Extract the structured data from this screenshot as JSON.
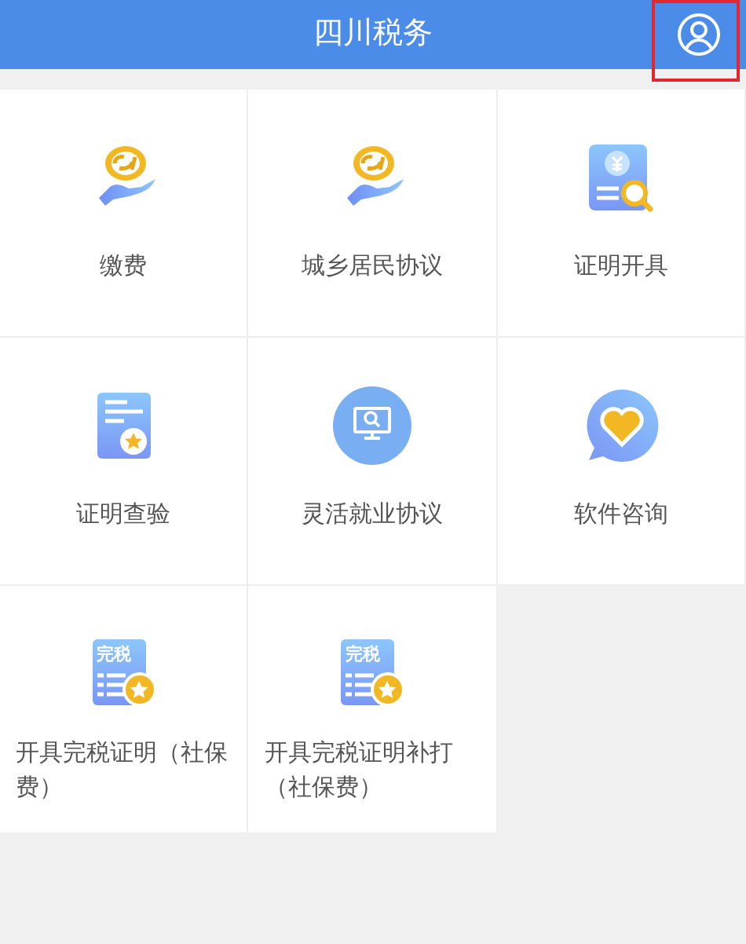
{
  "header": {
    "title": "四川税务",
    "highlighted_button": true
  },
  "items": [
    {
      "kind": "coin-hand",
      "label": "缴费"
    },
    {
      "kind": "coin-hand",
      "label": "城乡居民协议"
    },
    {
      "kind": "yuan-search",
      "label": "证明开具"
    },
    {
      "kind": "doc-star",
      "label": "证明查验"
    },
    {
      "kind": "monitor-search",
      "label": "灵活就业协议"
    },
    {
      "kind": "heart-chat",
      "label": "软件咨询"
    },
    {
      "kind": "tax-star",
      "icon_text": "完税",
      "label": "开具完税证明（社保费）"
    },
    {
      "kind": "tax-star",
      "icon_text": "完税",
      "label": "开具完税证明补打（社保费）"
    }
  ]
}
